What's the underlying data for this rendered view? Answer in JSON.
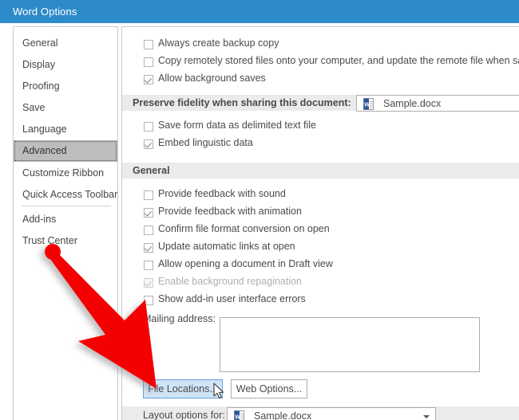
{
  "window": {
    "title": "Word Options",
    "titlebar_color": "#2e8bca"
  },
  "sidebar": {
    "items": [
      {
        "label": "General",
        "selected": false
      },
      {
        "label": "Display",
        "selected": false
      },
      {
        "label": "Proofing",
        "selected": false
      },
      {
        "label": "Save",
        "selected": false
      },
      {
        "label": "Language",
        "selected": false
      },
      {
        "label": "Advanced",
        "selected": true
      },
      {
        "label": "Customize Ribbon",
        "selected": false
      },
      {
        "label": "Quick Access Toolbar",
        "selected": false
      },
      {
        "label": "Add-ins",
        "selected": false
      },
      {
        "label": "Trust Center",
        "selected": false
      }
    ]
  },
  "content": {
    "save_options": [
      {
        "label": "Always create backup copy",
        "checked": false,
        "disabled": false
      },
      {
        "label": "Copy remotely stored files onto your computer, and update the remote file when saving",
        "checked": false,
        "disabled": false
      },
      {
        "label": "Allow background saves",
        "checked": true,
        "disabled": false
      }
    ],
    "preserve_fidelity": {
      "label": "Preserve fidelity when sharing this document:",
      "document": "Sample.docx"
    },
    "fidelity_options": [
      {
        "label": "Save form data as delimited text file",
        "checked": false,
        "disabled": false
      },
      {
        "label": "Embed linguistic data",
        "checked": true,
        "disabled": false
      }
    ],
    "general_header": "General",
    "general_options": [
      {
        "label": "Provide feedback with sound",
        "checked": false,
        "disabled": false
      },
      {
        "label": "Provide feedback with animation",
        "checked": true,
        "disabled": false
      },
      {
        "label": "Confirm file format conversion on open",
        "checked": false,
        "disabled": false
      },
      {
        "label": "Update automatic links at open",
        "checked": true,
        "disabled": false
      },
      {
        "label": "Allow opening a document in Draft view",
        "checked": false,
        "disabled": false
      },
      {
        "label": "Enable background repagination",
        "checked": true,
        "disabled": true
      },
      {
        "label": "Show add-in user interface errors",
        "checked": false,
        "disabled": false
      }
    ],
    "mailing_address": {
      "label": "Mailing address:",
      "value": ""
    },
    "buttons": {
      "file_locations": "File Locations...",
      "web_options": "Web Options..."
    },
    "layout_options": {
      "label": "Layout options for:",
      "document": "Sample.docx"
    }
  },
  "annotation": {
    "arrow_color": "#f50000",
    "description": "red arrow pointing to File Locations button"
  }
}
